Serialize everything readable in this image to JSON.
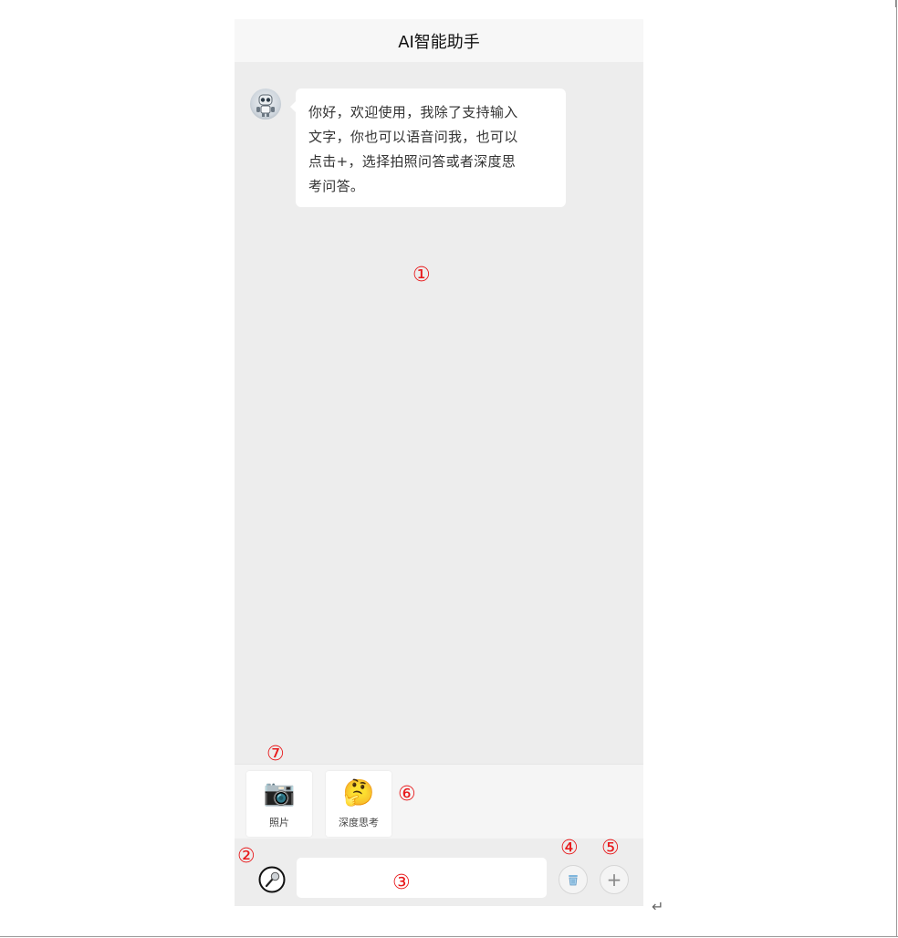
{
  "header": {
    "title": "AI智能助手"
  },
  "chat": {
    "messages": [
      {
        "role": "assistant",
        "avatar_icon": "robot-icon",
        "lines": [
          "你好，欢迎使用，我除了支持输入",
          "文字，你也可以语音问我，也可以",
          "点击+，选择拍照问答或者深度思",
          "考问答。"
        ]
      }
    ]
  },
  "tools": {
    "items": [
      {
        "label": "照片",
        "icon": "📷",
        "icon_name": "camera-icon"
      },
      {
        "label": "深度思考",
        "icon": "🤔",
        "icon_name": "thinking-face-icon"
      }
    ]
  },
  "input": {
    "value": "",
    "placeholder": ""
  },
  "buttons": {
    "voice_icon": "microphone-icon",
    "clear_icon": "trash-icon",
    "add_label": "+"
  },
  "annotations": {
    "m1": "①",
    "m2": "②",
    "m3": "③",
    "m4": "④",
    "m5": "⑤",
    "m6": "⑥",
    "m7": "⑦"
  },
  "doc": {
    "paragraph_mark": "↵"
  },
  "colors": {
    "marker": "#e8191b",
    "chat_bg": "#ededed",
    "header_bg": "#f7f7f7",
    "bubble_bg": "#ffffff"
  }
}
